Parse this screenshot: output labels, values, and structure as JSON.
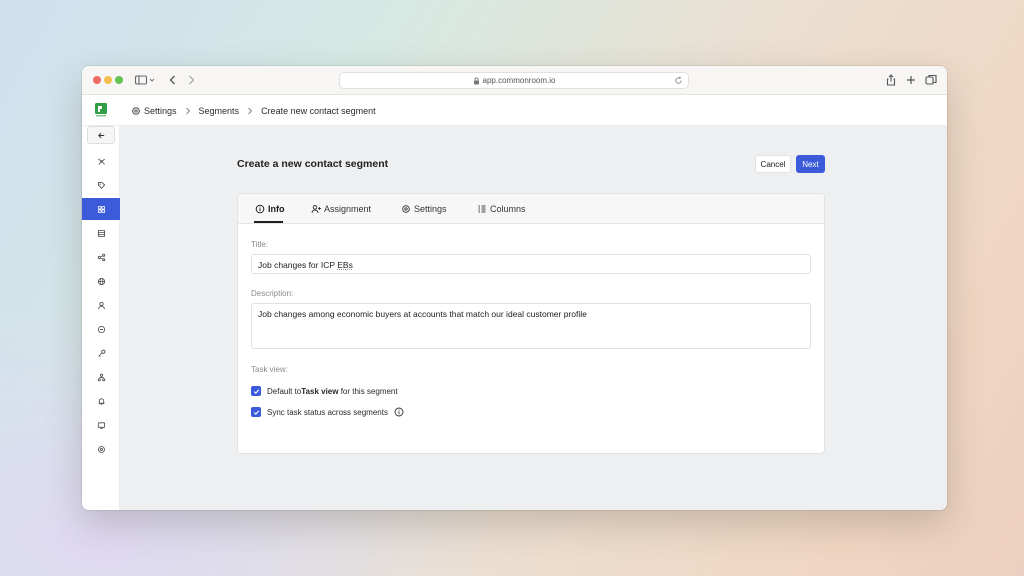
{
  "browser": {
    "url": "app.commonroom.io"
  },
  "breadcrumb": {
    "items": [
      "Settings",
      "Segments",
      "Create new contact segment"
    ]
  },
  "page": {
    "title": "Create a new contact segment",
    "cancel_label": "Cancel",
    "next_label": "Next"
  },
  "tabs": [
    {
      "label": "Info",
      "icon": "info-icon"
    },
    {
      "label": "Assignment",
      "icon": "user-plus-icon"
    },
    {
      "label": "Settings",
      "icon": "gear-icon"
    },
    {
      "label": "Columns",
      "icon": "columns-icon"
    }
  ],
  "form": {
    "title_label": "Title:",
    "title_value_prefix": "Job changes for ICP ",
    "title_value_underlined": "EBs",
    "description_label": "Description:",
    "description_value": "Job changes among economic buyers at accounts that match our ideal customer profile",
    "task_view_label": "Task view:",
    "checkbox1_prefix": "Default to ",
    "checkbox1_bold": "Task view",
    "checkbox1_suffix": " for this segment",
    "checkbox1_checked": true,
    "checkbox2_label": "Sync task status across segments",
    "checkbox2_checked": true
  },
  "colors": {
    "accent": "#3b5bdb",
    "brand": "#2f9e44"
  }
}
